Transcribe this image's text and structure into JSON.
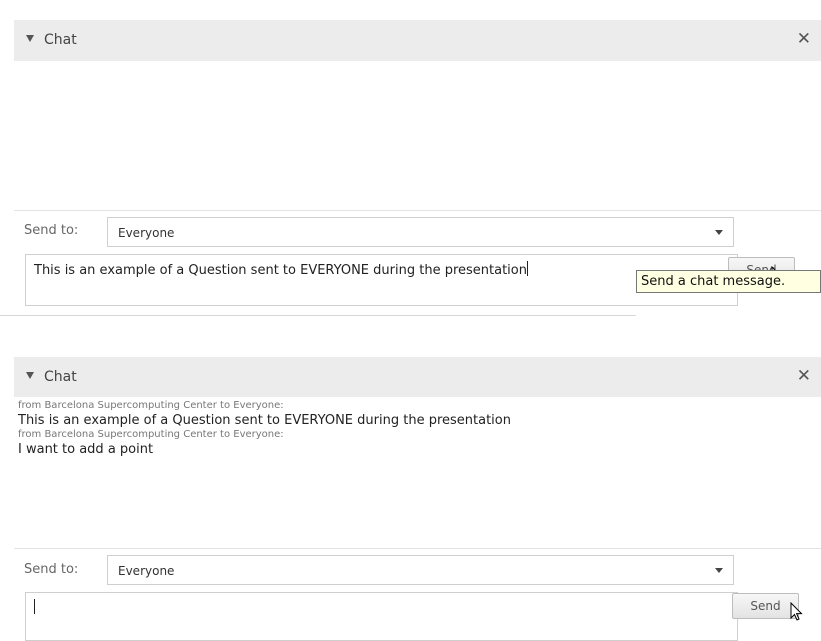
{
  "panel1": {
    "title": "Chat",
    "send_to_label": "Send to:",
    "recipient": "Everyone",
    "input_value": "This is an example of a Question sent to EVERYONE during the presentation",
    "send_label": "Send",
    "tooltip": "Send a chat message."
  },
  "panel2": {
    "title": "Chat",
    "messages": [
      {
        "meta": "from Barcelona Supercomputing Center to Everyone:",
        "text": "This is an example of a Question sent to EVERYONE during the presentation"
      },
      {
        "meta": "from Barcelona Supercomputing Center to Everyone:",
        "text": "I want to add a point"
      }
    ],
    "send_to_label": "Send to:",
    "recipient": "Everyone",
    "input_value": "",
    "send_label": "Send"
  },
  "icons": {
    "collapse": "triangle-down-icon",
    "close": "close-icon",
    "dropdown": "caret-down-icon",
    "cursor": "mouse-pointer-icon"
  }
}
